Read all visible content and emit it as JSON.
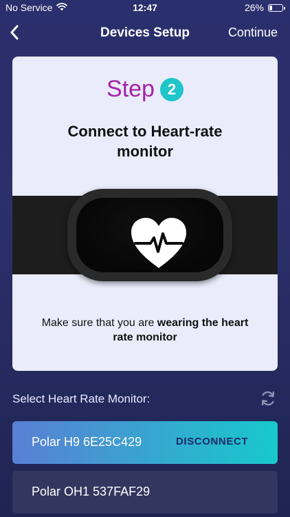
{
  "status_bar": {
    "carrier": "No Service",
    "time": "12:47",
    "battery_percent_label": "26%",
    "battery_level": 0.26
  },
  "nav": {
    "title": "Devices Setup",
    "action_label": "Continue"
  },
  "card": {
    "step_word": "Step",
    "step_number": "2",
    "title": "Connect to Heart-rate monitor",
    "caption_prefix": "Make sure that you are ",
    "caption_bold": "wearing the heart rate monitor"
  },
  "devices_section": {
    "label": "Select Heart Rate Monitor:",
    "devices": [
      {
        "name": "Polar H9 6E25C429",
        "action": "DISCONNECT"
      },
      {
        "name": "Polar OH1 537FAF29"
      }
    ]
  },
  "colors": {
    "step_accent": "#a223a8",
    "step_badge": "#1ec5c9",
    "active_device_gradient_start": "#5a7fd4",
    "active_device_gradient_end": "#17c9cc"
  }
}
